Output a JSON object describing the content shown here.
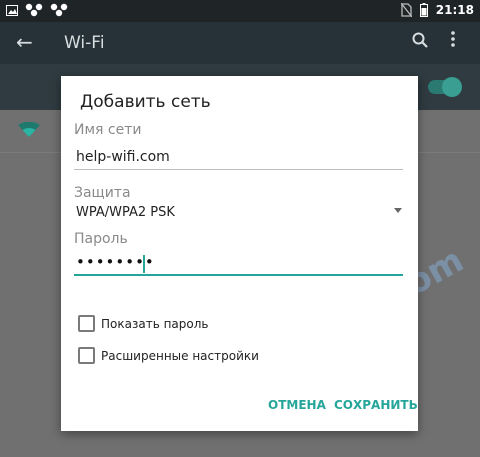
{
  "status_bar": {
    "time": "21:18",
    "icons": [
      "image-icon",
      "cluster-icon",
      "cluster-icon",
      "no-sim-icon",
      "battery-icon"
    ]
  },
  "app_bar": {
    "title": "Wi-Fi",
    "icons": [
      "back-arrow-icon",
      "search-icon",
      "more-vert-icon"
    ]
  },
  "toggle": {
    "on": true
  },
  "watermark": "help-wifi.com",
  "colors": {
    "accent": "#26a69a",
    "app_bar": "#263238"
  },
  "dialog": {
    "title": "Добавить сеть",
    "ssid": {
      "label": "Имя сети",
      "value": "help-wifi.com"
    },
    "security": {
      "label": "Защита",
      "value": "WPA/WPA2 PSK"
    },
    "password": {
      "label": "Пароль",
      "value": "••••••••"
    },
    "show_password": {
      "label": "Показать пароль",
      "checked": false
    },
    "advanced": {
      "label": "Расширенные настройки",
      "checked": false
    },
    "buttons": {
      "cancel": "ОТМЕНА",
      "save": "СОХРАНИТЬ"
    }
  }
}
